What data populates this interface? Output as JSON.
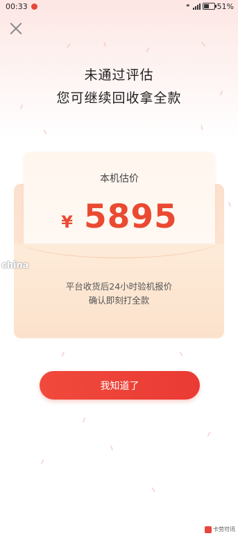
{
  "status_bar": {
    "time": "00:33",
    "battery": "51%",
    "battery_level": 0.51
  },
  "header": {
    "title_line1": "未通过评估",
    "title_line2": "您可继续回收拿全款"
  },
  "estimate_card": {
    "label": "本机估价",
    "currency": "¥",
    "amount": "5895",
    "note_line1": "平台收货后24小时验机报价",
    "note_line2": "确认即刻打全款"
  },
  "primary_button": {
    "label": "我知道了"
  },
  "watermark": {
    "text": "china"
  },
  "corner_logo": {
    "text": "卡劳可讯"
  },
  "colors": {
    "accent": "#ea4a32",
    "button": "#ef4339",
    "card": "#fde9d8",
    "background_top": "#fde6e4"
  }
}
